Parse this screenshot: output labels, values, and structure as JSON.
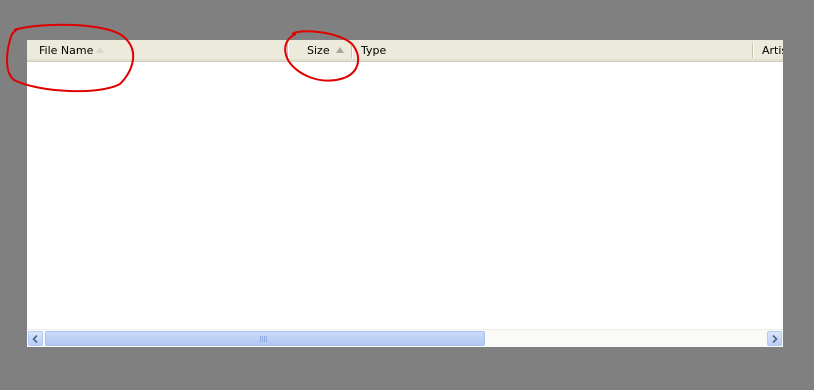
{
  "listview": {
    "columns": [
      {
        "label": "File Name",
        "sort_indicator": "faint-up-arrow"
      },
      {
        "label": "Size",
        "sort_indicator": "up-arrow"
      },
      {
        "label": "Type",
        "sort_indicator": "none"
      },
      {
        "label": "Artis",
        "sort_indicator": "none"
      }
    ],
    "rows": []
  },
  "scrollbar": {
    "left_icon": "scroll-left-icon",
    "right_icon": "scroll-right-icon",
    "thumb_fraction": 0.59
  },
  "annotations": {
    "color": "#e00000",
    "marks": [
      "circle around File Name header",
      "circle around Size header"
    ]
  },
  "colors": {
    "background": "#808080",
    "header": "#ebeadb",
    "list": "#ffffff",
    "scroll_thumb": "#c0d3f8"
  }
}
